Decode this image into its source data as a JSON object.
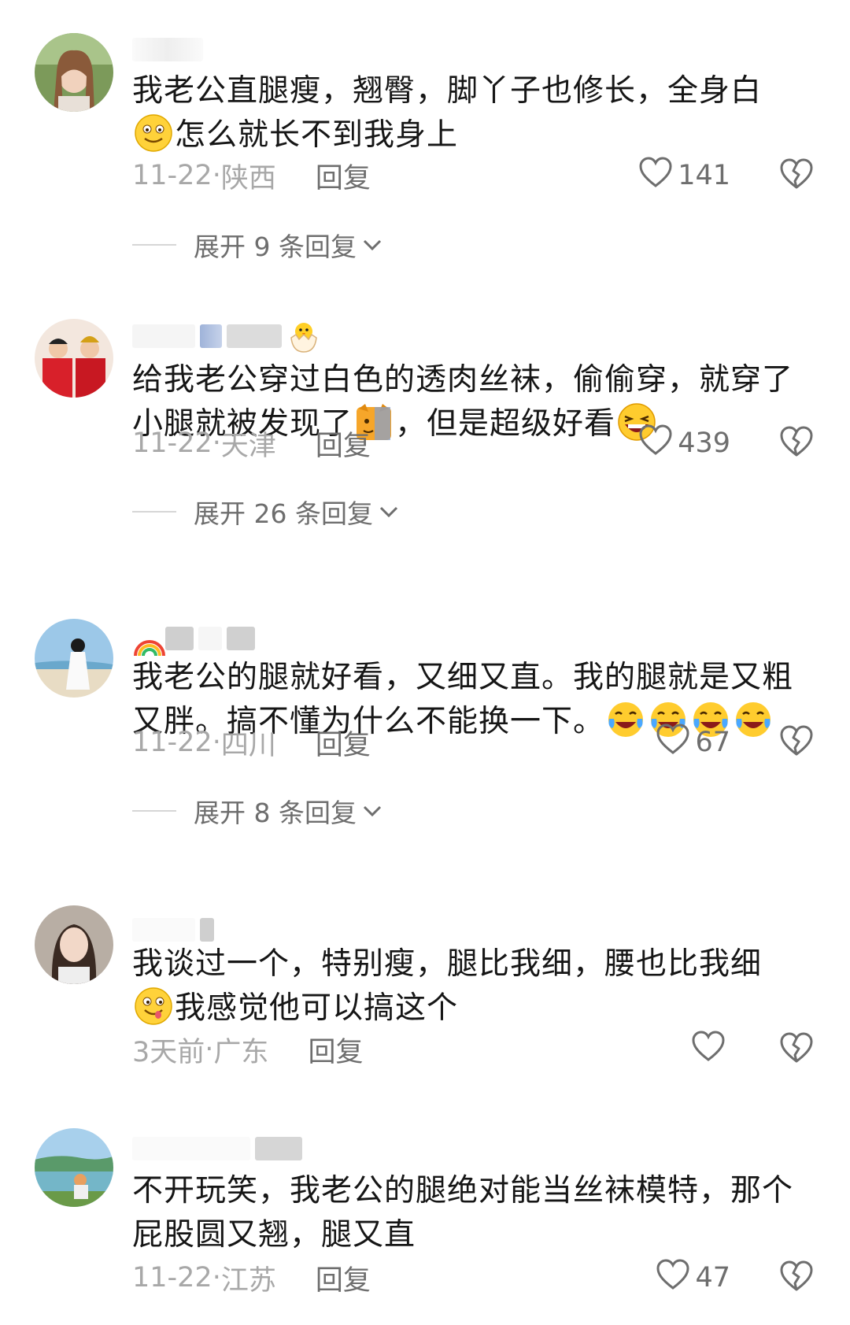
{
  "comments": [
    {
      "text_line1": "我老公直腿瘦，翘臀，脚丫子也修长，全身白",
      "text_line2": "怎么就长不到我身上",
      "time": "11-22",
      "location": "陕西",
      "reply_label": "回复",
      "likes": "141",
      "expand_label": "展开 9 条回复"
    },
    {
      "text_line1": "给我老公穿过白色的透肉丝袜，偷偷穿，就穿了",
      "text_line2a": "小腿就被发现了",
      "text_line2b": "，但是超级好看",
      "time": "11-22",
      "location": "天津",
      "reply_label": "回复",
      "likes": "439",
      "expand_label": "展开 26 条回复"
    },
    {
      "text_line1": "我老公的腿就好看，又细又直。我的腿就是又粗",
      "text_line2": "又胖。搞不懂为什么不能换一下。",
      "time": "11-22",
      "location": "四川",
      "reply_label": "回复",
      "likes": "67",
      "expand_label": "展开 8 条回复"
    },
    {
      "text_line1": "我谈过一个，特别瘦，腿比我细，腰也比我细",
      "text_line2": "我感觉他可以搞这个",
      "time": "3天前",
      "location": "广东",
      "reply_label": "回复",
      "likes": ""
    },
    {
      "text_line1": "不开玩笑，我老公的腿绝对能当丝袜模特，那个",
      "text_line2": "屁股圆又翘，腿又直",
      "time": "11-22",
      "location": "江苏",
      "reply_label": "回复",
      "likes": "47"
    }
  ],
  "icons": {
    "like": "heart-outline-icon",
    "dislike": "broken-heart-icon",
    "expand": "chevron-down-icon"
  },
  "colors": {
    "text": "#161616",
    "meta": "#a8a8a8",
    "action": "#6e6e6e"
  }
}
